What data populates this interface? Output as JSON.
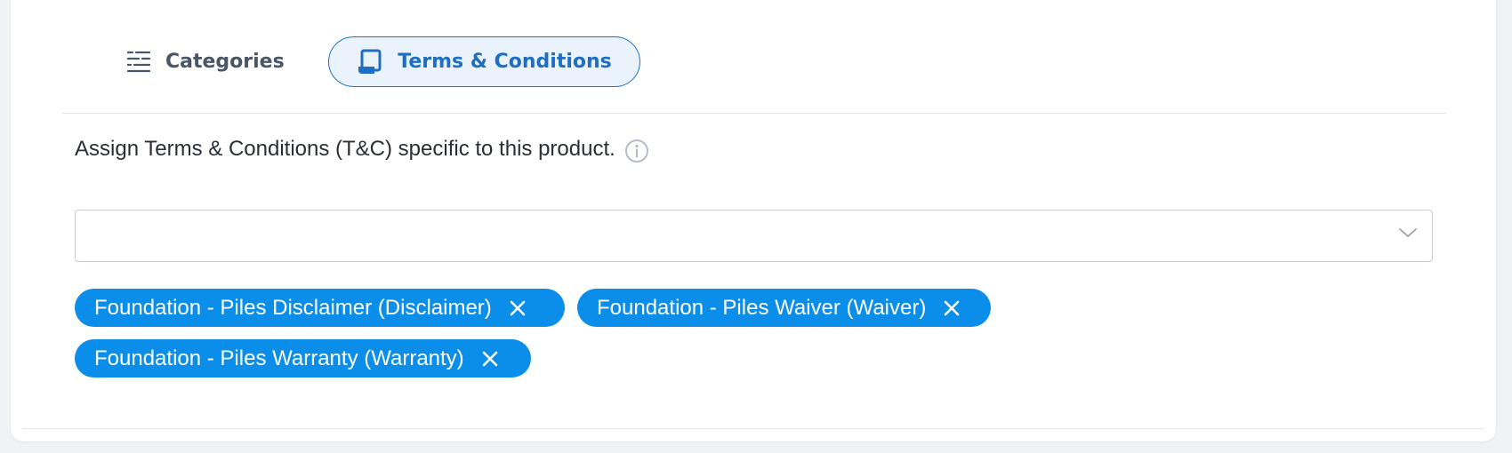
{
  "tabs": {
    "categories_label": "Categories",
    "terms_label": "Terms & Conditions",
    "active": "Terms & Conditions"
  },
  "terms": {
    "instruction": "Assign Terms & Conditions (T&C) specific to this product.",
    "select_value": "",
    "selected_chips": [
      {
        "label": "Foundation - Piles Disclaimer (Disclaimer)"
      },
      {
        "label": "Foundation - Piles Waiver (Waiver)"
      },
      {
        "label": "Foundation - Piles Warranty (Warranty)"
      }
    ]
  },
  "colors": {
    "accent": "#1e73c8",
    "chip_bg": "#0b8ee9",
    "active_tab_bg": "#eaf3fc"
  },
  "icons": {
    "categories": "categories-icon",
    "terms": "scroll-document-icon",
    "info": "info-icon",
    "dropdown": "chevron-down-icon",
    "remove": "close-icon"
  }
}
